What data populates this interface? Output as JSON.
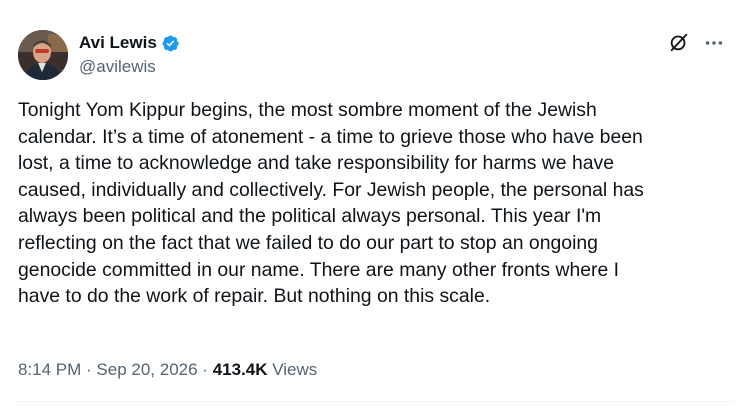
{
  "author": {
    "display_name": "Avi Lewis",
    "handle": "@avilewis",
    "verified": true
  },
  "icons": {
    "verified": "verified-badge-icon",
    "grok": "grok-icon",
    "more": "more-options-icon"
  },
  "colors": {
    "verified_badge": "#1d9bf0",
    "primary_text": "#0f1419",
    "secondary_text": "#536471"
  },
  "tweet": {
    "text": "Tonight Yom Kippur begins, the most sombre moment of the Jewish\ncalendar. It’s a time of atonement - a time to grieve those who have been\nlost, a time to acknowledge and take responsibility for harms we have\ncaused, individually and collectively. For Jewish people, the personal has\nalways been political and the political always personal. This year I'm\nreflecting on the fact that we failed to do our part to stop an ongoing\ngenocide committed in our name. There are many other fronts where I\nhave to do the work of repair. But nothing on this scale."
  },
  "meta": {
    "time": "8:14 PM",
    "separator": " · ",
    "date": "Sep 20, 2026",
    "views_count": "413.4K",
    "views_label": " Views"
  }
}
